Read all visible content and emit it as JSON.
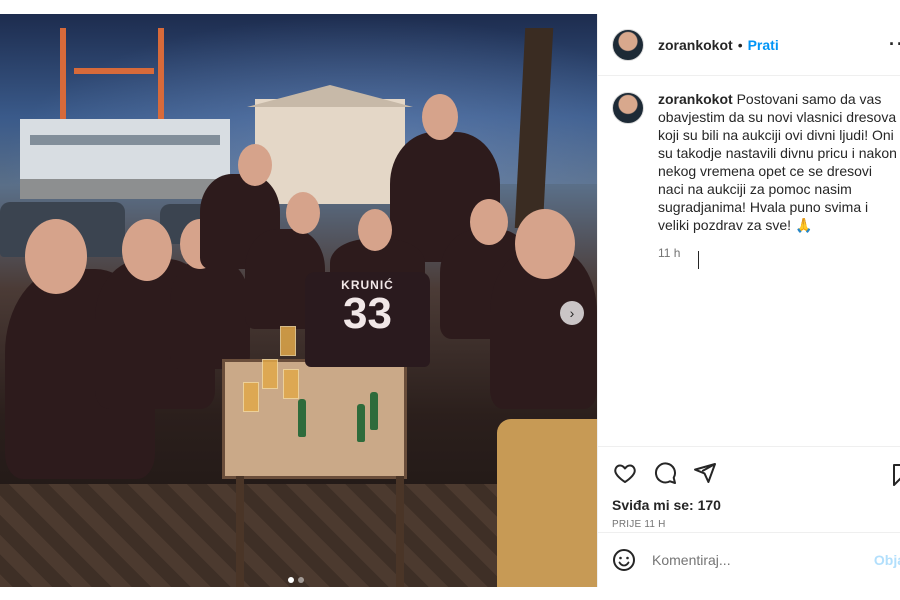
{
  "post": {
    "username": "zorankokot",
    "separator": "•",
    "follow_label": "Prati",
    "more_label": "··",
    "caption_text": "Postovani samo da vas obavjestim da su novi vlasnici dresova koji su bili na aukciji ovi divni ljudi! Oni su takodje nastavili divnu pricu i nakon nekog vremena opet ce se dresovi naci na aukciji za pomoc nasim sugradjanima! Hvala puno svima i veliki pozdrav za sve! 🙏",
    "caption_time": "11 h",
    "likes": "Sviđa mi se: 170",
    "post_date": "PRIJE 11 H",
    "comment_placeholder": "Komentiraj...",
    "post_button": "Obja"
  },
  "photo": {
    "jersey_name": "KRUNIĆ",
    "jersey_number": "33",
    "carousel_next": "›",
    "slide_count": 2,
    "active_slide": 1
  },
  "icons": {
    "like": "heart-icon",
    "comment": "comment-icon",
    "share": "share-icon",
    "save": "bookmark-icon",
    "emoji": "emoji-icon",
    "next": "chevron-right-icon",
    "more": "more-icon"
  },
  "colors": {
    "link": "#0095f6",
    "muted": "#737373",
    "text": "#262626",
    "post_disabled": "#b2dffc"
  }
}
